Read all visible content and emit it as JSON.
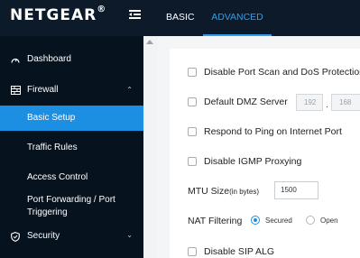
{
  "header": {
    "brand": "NETGEAR",
    "brand_mark": "®",
    "tabs": [
      {
        "label": "BASIC",
        "active": false
      },
      {
        "label": "ADVANCED",
        "active": true
      }
    ]
  },
  "sidebar": {
    "items": [
      {
        "label": "Dashboard",
        "icon": "gauge-icon"
      },
      {
        "label": "Firewall",
        "icon": "firewall-icon",
        "expanded": true
      },
      {
        "label": "Basic Setup",
        "active": true
      },
      {
        "label": "Traffic Rules"
      },
      {
        "label": "Access Control"
      },
      {
        "label": "Port Forwarding / Port",
        "label2": "Triggering"
      },
      {
        "label": "Security",
        "icon": "shield-icon"
      }
    ]
  },
  "settings": {
    "disable_port_scan": "Disable Port Scan and DoS Protection",
    "default_dmz": "Default DMZ Server",
    "dmz_ip": [
      "192",
      "168"
    ],
    "respond_ping": "Respond to Ping on Internet Port",
    "disable_igmp": "Disable IGMP Proxying",
    "mtu_label": "MTU Size",
    "mtu_unit": "(in bytes)",
    "mtu_value": "1500",
    "nat_label": "NAT Filtering",
    "nat_options": [
      "Secured",
      "Open"
    ],
    "nat_selected": "Secured",
    "disable_sip": "Disable SIP ALG"
  },
  "colors": {
    "accent": "#1d8fe3",
    "topbar": "#0c1a29",
    "sidebar": "#07121f"
  }
}
